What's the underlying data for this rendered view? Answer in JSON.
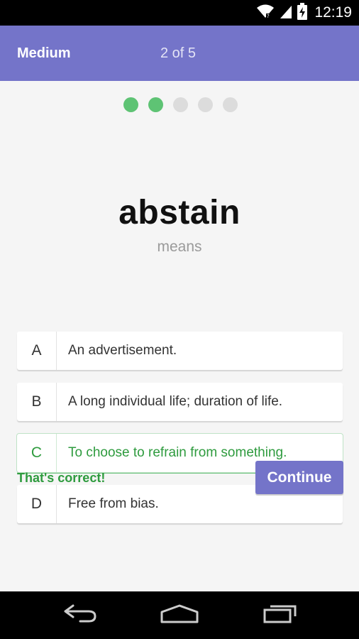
{
  "status_bar": {
    "time": "12:19",
    "icons": [
      "wifi-icon",
      "cell-signal-icon",
      "battery-charging-icon"
    ]
  },
  "header": {
    "difficulty": "Medium",
    "progress_text": "2 of 5"
  },
  "progress": {
    "completed": 2,
    "total": 5,
    "complete_color": "#5ec374",
    "pending_color": "#dcdcdc"
  },
  "question": {
    "word": "abstain",
    "connector": "means"
  },
  "answers": [
    {
      "letter": "A",
      "text": "An advertisement."
    },
    {
      "letter": "B",
      "text": "A long individual life; duration of life."
    },
    {
      "letter": "C",
      "text": "To choose to refrain from something."
    },
    {
      "letter": "D",
      "text": "Free from bias."
    }
  ],
  "selected_answer": "C",
  "feedback": "That's correct!",
  "continue_label": "Continue",
  "colors": {
    "accent": "#7474c9",
    "correct": "#2e9b3e",
    "background": "#f5f5f5"
  },
  "nav_bar": {
    "icons": [
      "back-icon",
      "home-icon",
      "recent-apps-icon"
    ]
  }
}
